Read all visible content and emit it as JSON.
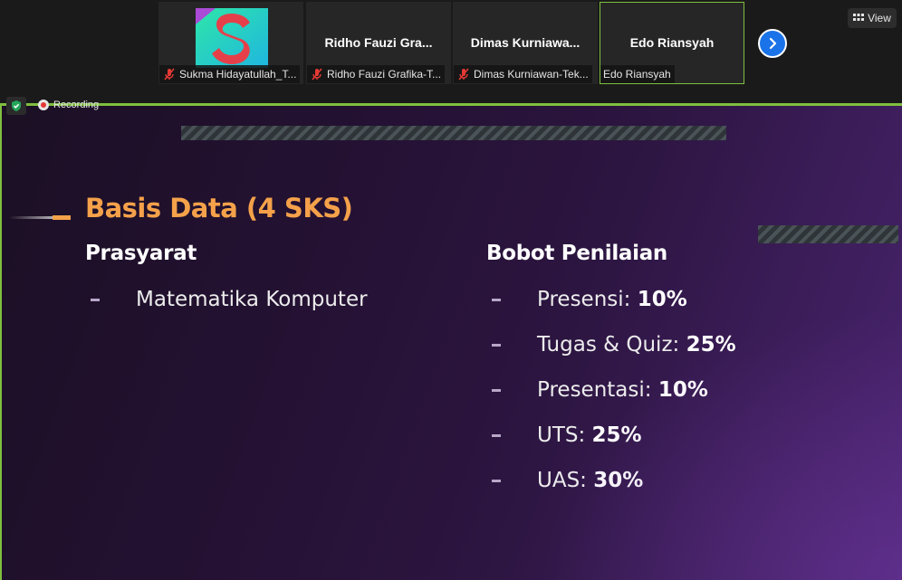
{
  "participants": [
    {
      "name": "",
      "caption": "Sukma Hidayatullah_T...",
      "muted": true,
      "has_avatar": true
    },
    {
      "name": "Ridho Fauzi Gra...",
      "caption": "Ridho Fauzi Grafika-T...",
      "muted": true
    },
    {
      "name": "Dimas Kurniawa...",
      "caption": "Dimas Kurniawan-Tek...",
      "muted": true
    },
    {
      "name": "Edo Riansyah",
      "caption": "Edo Riansyah",
      "muted": false,
      "active": true
    }
  ],
  "view_label": "View",
  "recording_label": "Recording",
  "slide": {
    "title": "Basis Data (4 SKS)",
    "left_heading": "Prasyarat",
    "left_items": [
      "Matematika Komputer"
    ],
    "right_heading": "Bobot Penilaian",
    "right_items": [
      {
        "label": "Presensi: ",
        "value": "10%"
      },
      {
        "label": "Tugas & Quiz: ",
        "value": "25%"
      },
      {
        "label": "Presentasi: ",
        "value": "10%"
      },
      {
        "label": "UTS: ",
        "value": "25%"
      },
      {
        "label": "UAS: ",
        "value": "30%"
      }
    ]
  },
  "colors": {
    "accent_orange": "#f4a14a",
    "active_border": "#7fbf3f",
    "nav_blue": "#1a73e8",
    "mute_red": "#e53935"
  }
}
